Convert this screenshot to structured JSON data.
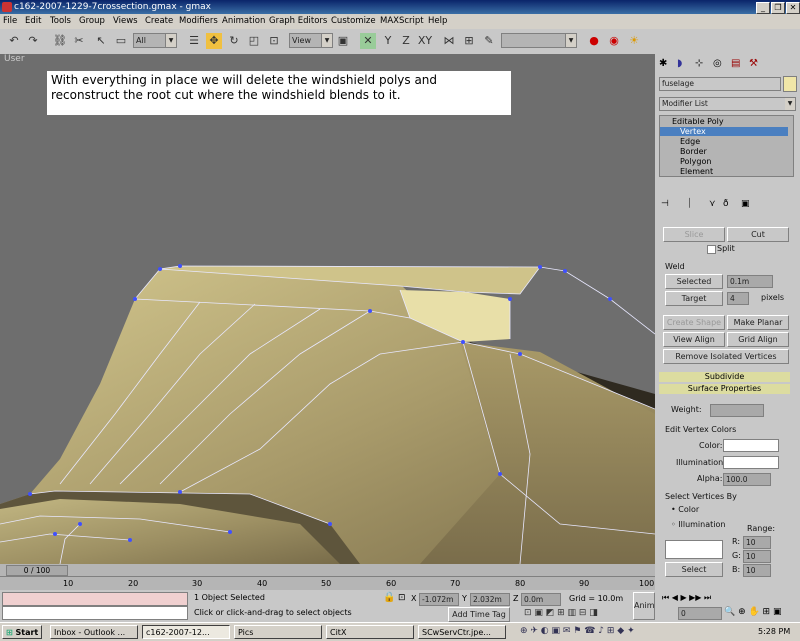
{
  "window": {
    "title": "c162-2007-1229-7crossection.gmax - gmax",
    "controls": [
      "_",
      "❐",
      "✕"
    ]
  },
  "menu": [
    "File",
    "Edit",
    "Tools",
    "Group",
    "Views",
    "Create",
    "Modifiers",
    "Animation",
    "Graph Editors",
    "Customize",
    "MAXScript",
    "Help"
  ],
  "toolbar": {
    "selection_filter": "All",
    "ref_coord": "View"
  },
  "viewport": {
    "label": "User",
    "caption": "With everything in place we will delete the windshield polys and reconstruct the root cut where the windshield blends to it."
  },
  "panel": {
    "object_name": "fuselage",
    "modifier_list": "Modifier List",
    "stack": [
      "Editable Poly",
      "Vertex",
      "Edge",
      "Border",
      "Polygon",
      "Element"
    ],
    "slice_label": "Slice",
    "cut_label": "Cut",
    "split_label": "Split",
    "weld_label": "Weld",
    "weld_selected": "Selected",
    "weld_selected_value": "0.1m",
    "weld_target": "Target",
    "weld_target_value": "4",
    "pixels_label": "pixels",
    "create_shape": "Create Shape",
    "make_planar": "Make Planar",
    "view_align": "View Align",
    "grid_align": "Grid Align",
    "remove_isolated": "Remove Isolated Vertices",
    "subdivide": "Subdivide",
    "surface_properties": "Surface Properties",
    "weight_label": "Weight:",
    "edit_vertex_colors": "Edit Vertex Colors",
    "color_label": "Color:",
    "illumination_label": "Illumination:",
    "alpha_label": "Alpha:",
    "alpha_value": "100.0",
    "select_vertices_by": "Select Vertices By",
    "by_color": "Color",
    "by_illumination": "Illumination",
    "range_label": "Range:",
    "r_label": "R:",
    "g_label": "G:",
    "b_label": "B:",
    "range_r": "10",
    "range_g": "10",
    "range_b": "10",
    "select_label": "Select"
  },
  "timeline": {
    "frame": "0 / 100",
    "ticks": [
      "10",
      "20",
      "30",
      "40",
      "50",
      "60",
      "70",
      "80",
      "90",
      "100"
    ]
  },
  "status": {
    "selection": "1 Object Selected",
    "prompt": "Click or click-and-drag to select objects",
    "x_label": "X",
    "x_value": "-1.072m",
    "y_label": "Y",
    "y_value": "2.032m",
    "z_label": "Z",
    "z_value": "0.0m",
    "grid": "Grid = 10.0m",
    "add_time_tag": "Add Time Tag",
    "anim": "Anim",
    "frame_field": "0"
  },
  "taskbar": {
    "start": "Start",
    "tasks": [
      "Inbox - Outlook ...",
      "c162-2007-12...",
      "Pics",
      "CitX",
      "SCwServCtr.jpe..."
    ],
    "clock": "5:28 PM"
  },
  "colors": {
    "mesh_top": "#c9bd84",
    "mesh_mid": "#a49466",
    "mesh_dark": "#3d372a",
    "selected_poly": "#e8dfa8",
    "viewport_bg": "#6e6e6e"
  }
}
